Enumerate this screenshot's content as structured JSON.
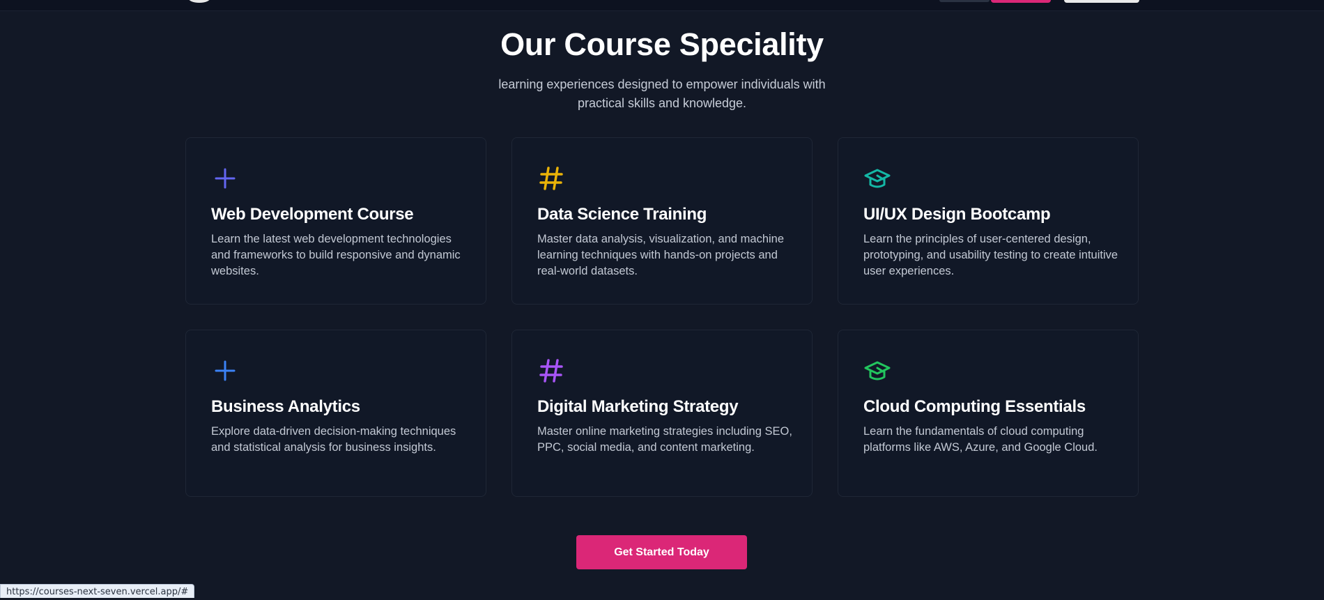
{
  "header": {
    "title": "Our Course Speciality",
    "subtitle": "learning experiences designed to empower individuals with practical skills and knowledge."
  },
  "courses": [
    {
      "title": "Web Development Course",
      "description": "Learn the latest web development technologies and frameworks to build responsive and dynamic websites.",
      "icon": "plus-icon",
      "icon_color": "#6366f1"
    },
    {
      "title": "Data Science Training",
      "description": "Master data analysis, visualization, and machine learning techniques with hands-on projects and real-world datasets.",
      "icon": "hash-icon",
      "icon_color": "#eab308"
    },
    {
      "title": "UI/UX Design Bootcamp",
      "description": "Learn the principles of user-centered design, prototyping, and usability testing to create intuitive user experiences.",
      "icon": "graduation-cap-icon",
      "icon_color": "#14b8a6"
    },
    {
      "title": "Business Analytics",
      "description": "Explore data-driven decision-making techniques and statistical analysis for business insights.",
      "icon": "plus-icon",
      "icon_color": "#3b82f6"
    },
    {
      "title": "Digital Marketing Strategy",
      "description": "Master online marketing strategies including SEO, PPC, social media, and content marketing.",
      "icon": "hash-icon",
      "icon_color": "#a855f7"
    },
    {
      "title": "Cloud Computing Essentials",
      "description": "Learn the fundamentals of cloud computing platforms like AWS, Azure, and Google Cloud.",
      "icon": "graduation-cap-icon",
      "icon_color": "#22c55e"
    }
  ],
  "cta": {
    "label": "Get Started Today",
    "color": "#db2777"
  },
  "status_bar": {
    "url": "https://courses-next-seven.vercel.app/#"
  },
  "colors": {
    "background": "#121826",
    "card_border": "#1f2736"
  }
}
